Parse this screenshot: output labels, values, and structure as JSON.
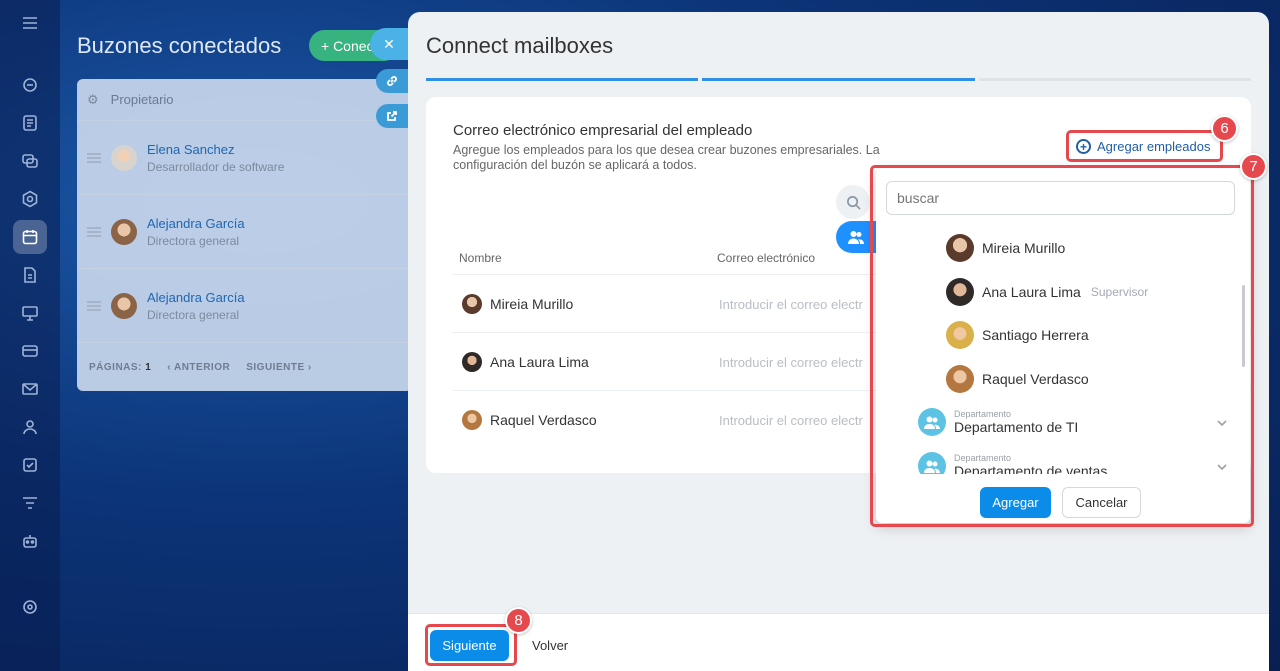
{
  "background_page": {
    "title": "Buzones conectados",
    "add_button": "+ Conectar",
    "table_header": "Propietario",
    "rows": [
      {
        "name": "Elena Sanchez",
        "role": "Desarrollador de software"
      },
      {
        "name": "Alejandra García",
        "role": "Directora general"
      },
      {
        "name": "Alejandra García",
        "role": "Directora general"
      }
    ],
    "pager": {
      "pages_label": "PÁGINAS:",
      "pages_value": "1",
      "prev": "‹ ANTERIOR",
      "next": "SIGUIENTE ›"
    }
  },
  "panel": {
    "title": "Connect mailboxes",
    "steps_total": 3,
    "steps_completed": 2,
    "card": {
      "heading": "Correo electrónico empresarial del empleado",
      "description": "Agregue los empleados para los que desea crear buzones empresariales. La configuración del buzón se aplicará a todos.",
      "add_employees": "Agregar empleados",
      "columns": [
        "Nombre",
        "Correo electrónico"
      ],
      "rows": [
        {
          "name": "Mireia Murillo",
          "email_placeholder": "Introducir el correo electr"
        },
        {
          "name": "Ana Laura Lima",
          "email_placeholder": "Introducir el correo electr"
        },
        {
          "name": "Raquel Verdasco",
          "email_placeholder": "Introducir el correo electr"
        }
      ]
    },
    "footer": {
      "next": "Siguiente",
      "back": "Volver"
    }
  },
  "popup": {
    "search_placeholder": "buscar",
    "people": [
      {
        "name": "Mireia Murillo",
        "tag": ""
      },
      {
        "name": "Ana Laura Lima",
        "tag": "Supervisor"
      },
      {
        "name": "Santiago Herrera",
        "tag": ""
      },
      {
        "name": "Raquel Verdasco",
        "tag": ""
      }
    ],
    "departments": [
      {
        "label": "Departamento",
        "name": "Departamento de TI"
      },
      {
        "label": "Departamento",
        "name": "Departamento de ventas"
      }
    ],
    "add": "Agregar",
    "cancel": "Cancelar"
  },
  "badges": {
    "step6": "6",
    "step7": "7",
    "step8": "8"
  },
  "colors": {
    "accent": "#0c8ce9",
    "highlight": "#e5494d",
    "progress": "#2f8fe2"
  }
}
